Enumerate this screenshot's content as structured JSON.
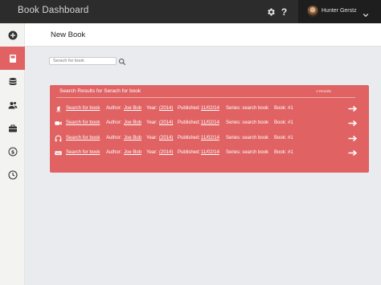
{
  "app": {
    "title": "Book Dashboard"
  },
  "user": {
    "name": "Hunter Gerstz"
  },
  "topbar": {
    "help_glyph": "?"
  },
  "icons": {
    "settings": "gear-icon",
    "help": "question-icon",
    "user_menu": "chevron-down-icon"
  },
  "sidebar": {
    "items": [
      {
        "name": "add",
        "icon": "plus-circle-icon",
        "active": false
      },
      {
        "name": "book",
        "icon": "book-icon",
        "active": true
      },
      {
        "name": "database",
        "icon": "database-icon",
        "active": false
      },
      {
        "name": "users",
        "icon": "users-icon",
        "active": false
      },
      {
        "name": "briefcase",
        "icon": "briefcase-icon",
        "active": false
      },
      {
        "name": "money",
        "icon": "dollar-icon",
        "active": false
      },
      {
        "name": "history",
        "icon": "clock-icon",
        "active": false
      }
    ]
  },
  "page": {
    "title": "New Book"
  },
  "search": {
    "placeholder": "Serach for book"
  },
  "results": {
    "title": "Search Results for Serach for book",
    "count": "4 Results",
    "rows": [
      {
        "icon": "chess-knight-icon",
        "title": "Search for book",
        "author_label": "Author:",
        "author": "Joe Bob",
        "year_label": "Year:",
        "year": "(2014)",
        "published_label": "Published:",
        "published": "11/02/14",
        "series_label": "Series: search book",
        "book_label": "Book: #1"
      },
      {
        "icon": "video-camera-icon",
        "title": "Search for book",
        "author_label": "Author:",
        "author": "Joe Bob",
        "year_label": "Year:",
        "year": "(2014)",
        "published_label": "Published:",
        "published": "11/02/14",
        "series_label": "Series: search book",
        "book_label": "Book: #1"
      },
      {
        "icon": "headphones-icon",
        "title": "Search for book",
        "author_label": "Author:",
        "author": "Joe Bob",
        "year_label": "Year:",
        "year": "(2014)",
        "published_label": "Published:",
        "published": "11/02/14",
        "series_label": "Series: search book",
        "book_label": "Book: #1"
      },
      {
        "icon": "keyboard-icon",
        "title": "Search for book",
        "author_label": "Author:",
        "author": "Joe Bob",
        "year_label": "Year:",
        "year": "(2014)",
        "published_label": "Published:",
        "published": "11/02/14",
        "series_label": "Series: search book",
        "book_label": "Book: #1"
      }
    ]
  },
  "colors": {
    "accent": "#e06263",
    "topbar": "#2c2c2c",
    "background": "#eaebef"
  }
}
